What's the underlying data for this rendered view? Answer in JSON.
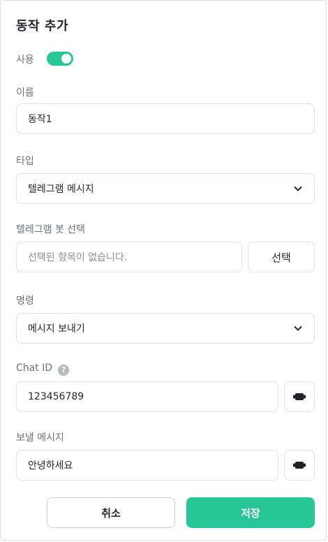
{
  "dialog": {
    "title": "동작 추가",
    "use_label": "사용",
    "use_enabled": true
  },
  "name": {
    "label": "이름",
    "value": "동작1"
  },
  "type": {
    "label": "타입",
    "selected": "텔레그램 메시지"
  },
  "bot": {
    "label": "텔레그램 봇 선택",
    "placeholder": "선택된 항목이 없습니다.",
    "select_button": "선택"
  },
  "command": {
    "label": "명령",
    "selected": "메시지 보내기"
  },
  "chat_id": {
    "label": "Chat ID",
    "help": "?",
    "value": "123456789"
  },
  "message": {
    "label": "보낼 메시지",
    "value": "안녕하세요"
  },
  "footer": {
    "cancel": "취소",
    "save": "저장"
  },
  "colors": {
    "accent": "#26c696"
  },
  "icons": {
    "help": "question-circle-icon",
    "chevron": "chevron-down-icon",
    "variable": "variable-block-icon"
  }
}
